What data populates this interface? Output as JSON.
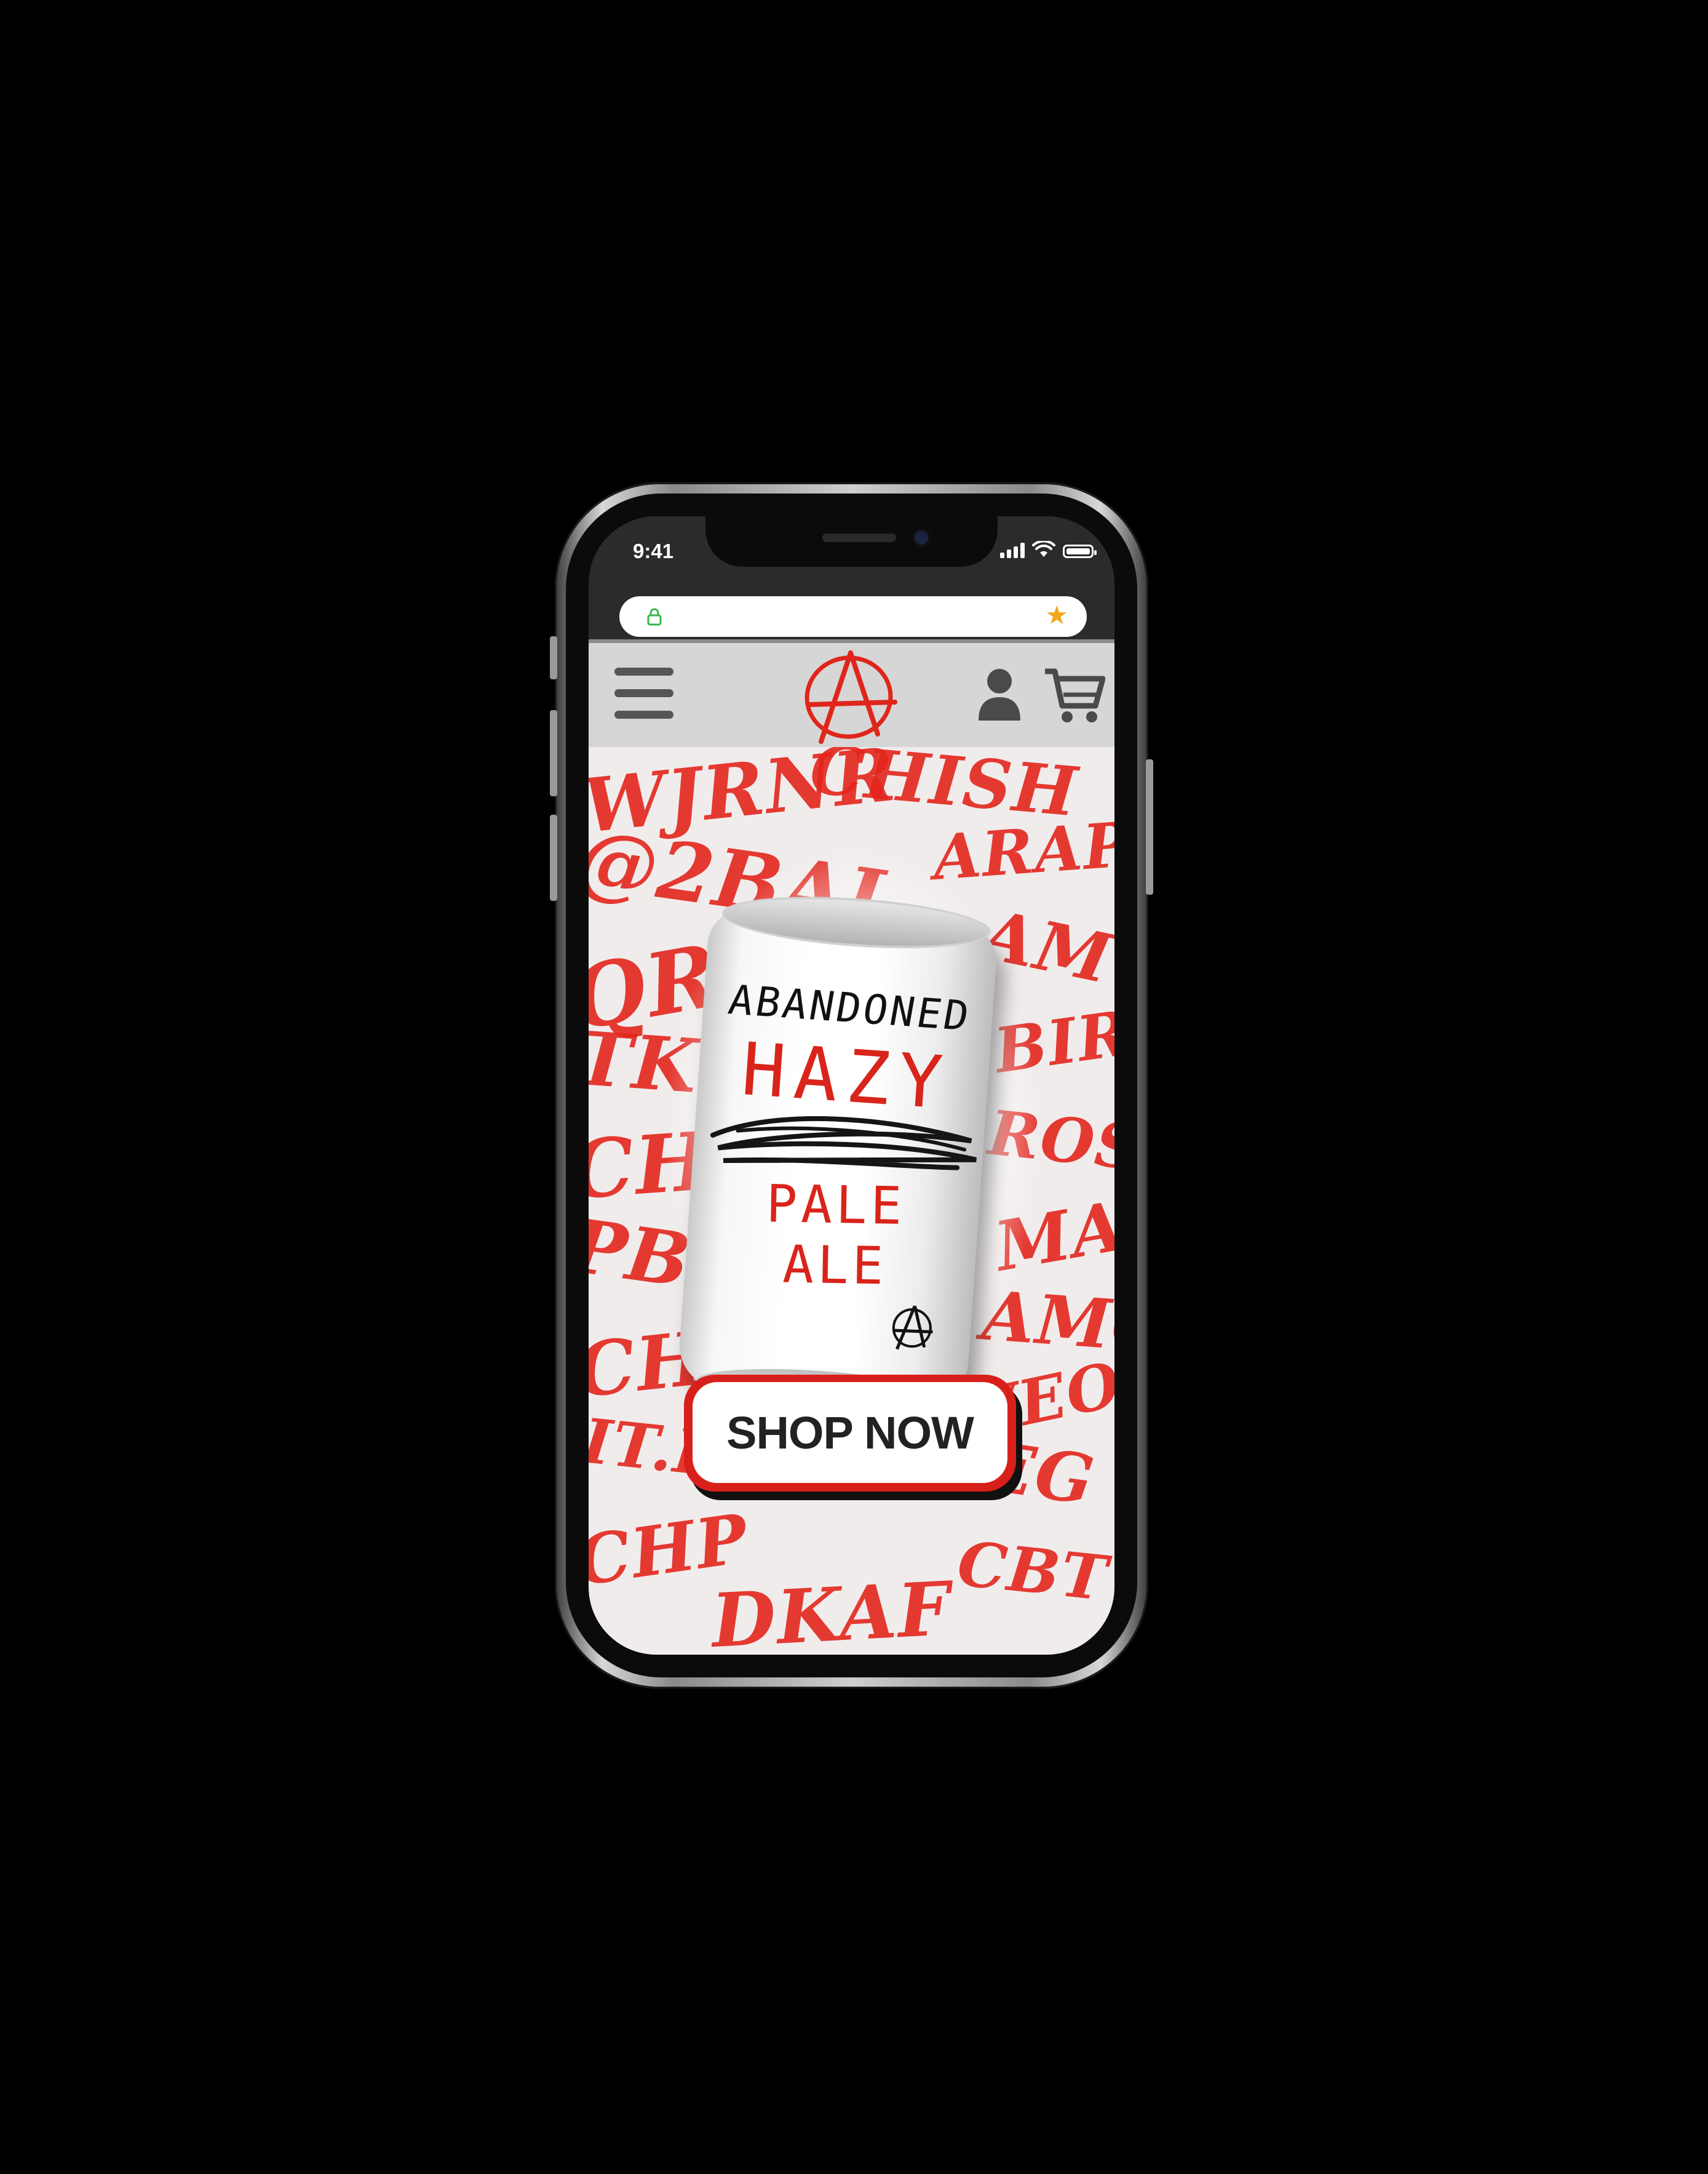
{
  "status_bar": {
    "time": "9:41"
  },
  "browser": {
    "lock_icon": "lock-icon",
    "bookmark_icon": "star-icon",
    "bookmark_color": "#f2a81d"
  },
  "header": {
    "menu_icon": "hamburger-menu-icon",
    "logo_icon": "anarchy-a-logo",
    "account_icon": "user-icon",
    "cart_icon": "cart-icon",
    "brand_color": "#d8201a"
  },
  "hero": {
    "product": {
      "brand": "ABANDONED",
      "style_strikethrough": "HAZY",
      "style": "PALE ALE"
    },
    "cta_label": "SHOP NOW",
    "accent_color": "#d8201a"
  }
}
